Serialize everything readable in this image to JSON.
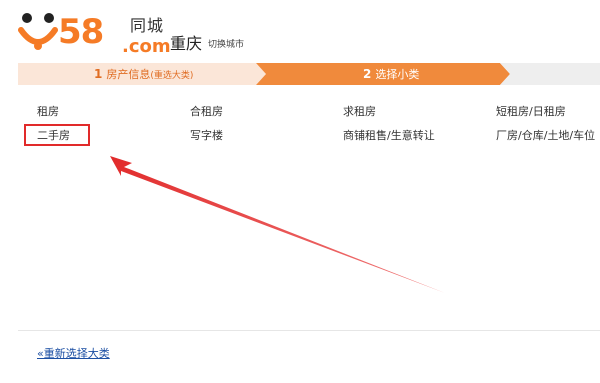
{
  "header": {
    "logo_number": "58",
    "logo_cn": "同城",
    "logo_com": ".com",
    "city": "重庆",
    "switch_city": "切换城市"
  },
  "steps": {
    "step1": {
      "num": "1",
      "label": "房产信息",
      "sub": "(重选大类)"
    },
    "step2": {
      "num": "2",
      "label": "选择小类"
    }
  },
  "categories": {
    "row1": [
      "租房",
      "合租房",
      "求租房",
      "短租房/日租房"
    ],
    "row2": [
      "二手房",
      "写字楼",
      "商铺租售/生意转让",
      "厂房/仓库/土地/车位"
    ]
  },
  "footer": {
    "reselect": "«重新选择大类"
  },
  "colors": {
    "brand_orange": "#f57b26",
    "step_active": "#f08a3c",
    "step_inactive": "#fbe6d8",
    "annotation_red": "#e12a2a",
    "link_blue": "#1c4fa3"
  }
}
